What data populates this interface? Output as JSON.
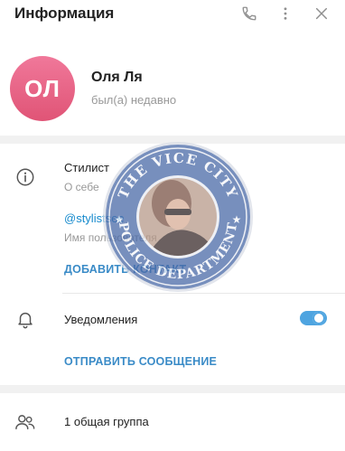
{
  "header": {
    "title": "Информация"
  },
  "profile": {
    "avatar_initials": "ОЛ",
    "avatar_color": "#e8607f",
    "name": "Оля Ля",
    "status": "был(а) недавно"
  },
  "info": {
    "bio": "Стилист",
    "bio_label": "О себе",
    "username": "@stylistsee",
    "username_label": "Имя пользователя",
    "add_contact": "ДОБАВИТЬ КОНТАКТ"
  },
  "notifications": {
    "label": "Уведомления",
    "enabled": true,
    "send_message": "ОТПРАВИТЬ СООБЩЕНИЕ"
  },
  "groups": {
    "label": "1 общая группа"
  },
  "watermark": {
    "top_text": "THE VICE CITY",
    "bottom_text": "POLICE DEPARTMENT"
  },
  "colors": {
    "accent": "#168acd",
    "toggle": "#4ea4e0",
    "muted": "#999999"
  }
}
